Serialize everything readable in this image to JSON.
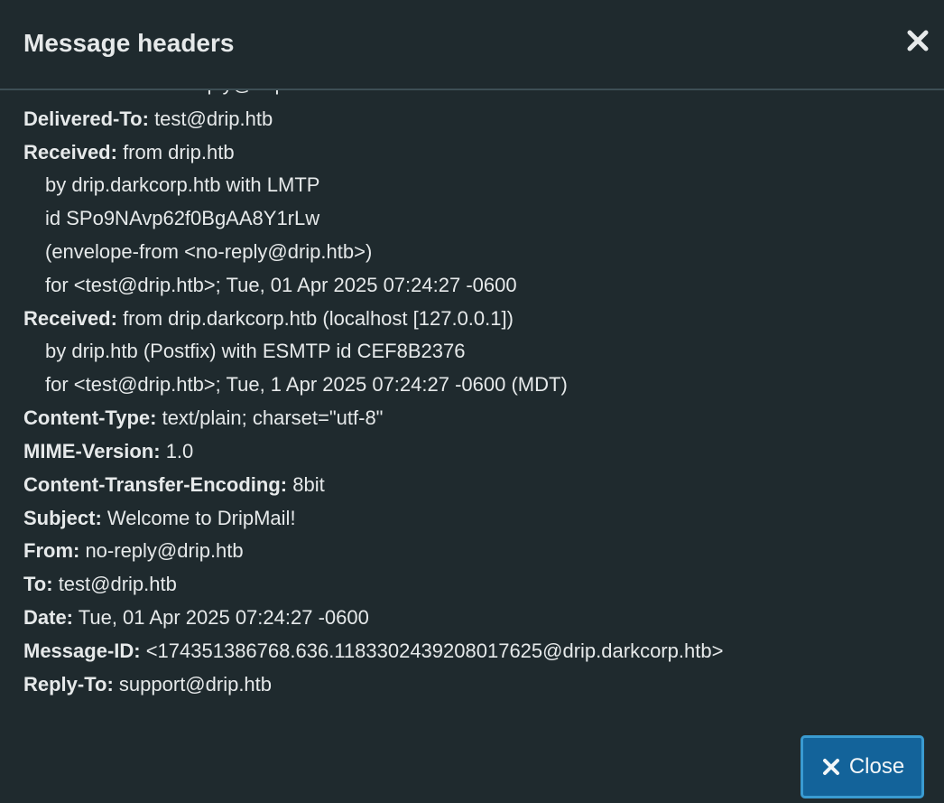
{
  "dialog": {
    "title": "Message headers",
    "close_button_label": "Close"
  },
  "headers": [
    {
      "name": "Delivered-To:",
      "value": " test@drip.htb"
    },
    {
      "name": "Received:",
      "value": " from drip.htb"
    },
    {
      "name": "",
      "value": "by drip.darkcorp.htb with LMTP"
    },
    {
      "name": "",
      "value": "id SPo9NAvp62f0BgAA8Y1rLw"
    },
    {
      "name": "",
      "value": "(envelope-from <no-reply@drip.htb>)"
    },
    {
      "name": "",
      "value": "for <test@drip.htb>; Tue, 01 Apr 2025 07:24:27 -0600"
    },
    {
      "name": "Received:",
      "value": " from drip.darkcorp.htb (localhost [127.0.0.1])"
    },
    {
      "name": "",
      "value": "by drip.htb (Postfix) with ESMTP id CEF8B2376"
    },
    {
      "name": "",
      "value": "for <test@drip.htb>; Tue, 1 Apr 2025 07:24:27 -0600 (MDT)"
    },
    {
      "name": "Content-Type:",
      "value": " text/plain; charset=\"utf-8\""
    },
    {
      "name": "MIME-Version:",
      "value": " 1.0"
    },
    {
      "name": "Content-Transfer-Encoding:",
      "value": " 8bit"
    },
    {
      "name": "Subject:",
      "value": " Welcome to DripMail!"
    },
    {
      "name": "From:",
      "value": " no-reply@drip.htb"
    },
    {
      "name": "To:",
      "value": " test@drip.htb"
    },
    {
      "name": "Date:",
      "value": " Tue, 01 Apr 2025 07:24:27 -0600"
    },
    {
      "name": "Message-ID:",
      "value": " <174351386768.636.11833024392080176​25@drip.darkcorp.htb>"
    },
    {
      "name": "Reply-To:",
      "value": " support@drip.htb"
    }
  ],
  "colors": {
    "background": "#1f2a2e",
    "text": "#e6e9ea",
    "button": "#13639a",
    "button_border": "#3a9bd1"
  }
}
